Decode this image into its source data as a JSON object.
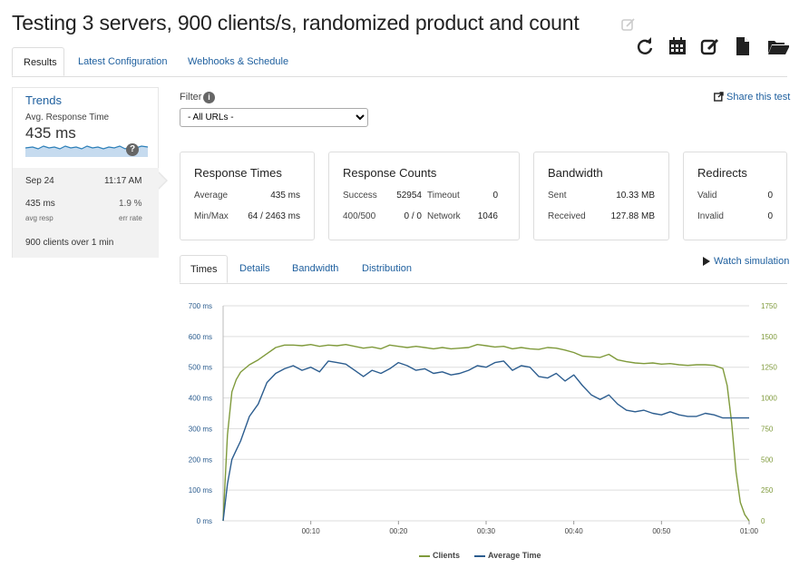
{
  "page": {
    "title": "Testing 3 servers, 900 clients/s, randomized product and count"
  },
  "toolbar": {
    "icons": [
      "refresh-icon",
      "calendar-icon",
      "edit-icon",
      "document-icon",
      "folder-icon"
    ]
  },
  "tabs": [
    {
      "label": "Results",
      "active": true
    },
    {
      "label": "Latest Configuration",
      "active": false
    },
    {
      "label": "Webhooks & Schedule",
      "active": false
    }
  ],
  "sidebar": {
    "trends_title": "Trends",
    "trends_subtitle": "Avg. Response Time",
    "trends_value": "435 ms",
    "help": "?",
    "selected": {
      "date": "Sep 24",
      "time": "11:17 AM",
      "avg_resp_value": "435 ms",
      "avg_resp_label": "avg resp",
      "err_rate_value": "1.9 %",
      "err_rate_label": "err rate",
      "clients_count": "900",
      "clients_text": "clients over 1 min"
    }
  },
  "filter": {
    "label": "Filter",
    "info": "i",
    "selected": "- All URLs -"
  },
  "share": {
    "label": "Share this test"
  },
  "cards": {
    "response_times": {
      "title": "Response Times",
      "average_label": "Average",
      "average_value": "435 ms",
      "minmax_label": "Min/Max",
      "minmax_value": "64 / 2463 ms"
    },
    "response_counts": {
      "title": "Response Counts",
      "success_label": "Success",
      "success_value": "52954",
      "timeout_label": "Timeout",
      "timeout_value": "0",
      "status_label": "400/500",
      "status_value": "0 / 0",
      "network_label": "Network",
      "network_value": "1046"
    },
    "bandwidth": {
      "title": "Bandwidth",
      "sent_label": "Sent",
      "sent_value": "10.33 MB",
      "received_label": "Received",
      "received_value": "127.88 MB"
    },
    "redirects": {
      "title": "Redirects",
      "valid_label": "Valid",
      "valid_value": "0",
      "invalid_label": "Invalid",
      "invalid_value": "0"
    }
  },
  "chart_tabs": [
    {
      "label": "Times",
      "active": true
    },
    {
      "label": "Details",
      "active": false
    },
    {
      "label": "Bandwidth",
      "active": false
    },
    {
      "label": "Distribution",
      "active": false
    }
  ],
  "watch": {
    "label": "Watch simulation"
  },
  "colors": {
    "link": "#1e5f9e",
    "clients": "#7f9a3b",
    "avg_time": "#2c5d8f",
    "spark": "#2c7fb8"
  },
  "chart_data": {
    "type": "line",
    "x_labels": [
      "00:10",
      "00:20",
      "00:30",
      "00:40",
      "00:50",
      "01:00"
    ],
    "x": [
      0,
      0.5,
      1,
      1.5,
      2,
      3,
      4,
      5,
      6,
      7,
      8,
      9,
      10,
      11,
      12,
      13,
      14,
      15,
      16,
      17,
      18,
      19,
      20,
      21,
      22,
      23,
      24,
      25,
      26,
      27,
      28,
      29,
      30,
      31,
      32,
      33,
      34,
      35,
      36,
      37,
      38,
      39,
      40,
      41,
      42,
      43,
      44,
      45,
      46,
      47,
      48,
      49,
      50,
      51,
      52,
      53,
      54,
      55,
      56,
      57,
      57.5,
      58,
      58.5,
      59,
      59.5,
      60
    ],
    "xlim": [
      0,
      60
    ],
    "y_left": {
      "label": "",
      "ticks": [
        "0 ms",
        "100 ms",
        "200 ms",
        "300 ms",
        "400 ms",
        "500 ms",
        "600 ms",
        "700 ms"
      ],
      "range": [
        0,
        700
      ]
    },
    "y_right": {
      "label": "",
      "ticks": [
        "0",
        "250",
        "500",
        "750",
        "1000",
        "1250",
        "1500",
        "1750"
      ],
      "range": [
        0,
        1750
      ]
    },
    "grid": true,
    "legend": "bottom-center",
    "series": [
      {
        "name": "Clients",
        "axis": "right",
        "color": "#7f9a3b",
        "values": [
          0,
          700,
          1050,
          1150,
          1210,
          1270,
          1310,
          1360,
          1410,
          1430,
          1430,
          1425,
          1435,
          1420,
          1430,
          1425,
          1435,
          1420,
          1405,
          1415,
          1400,
          1430,
          1420,
          1410,
          1420,
          1410,
          1400,
          1410,
          1400,
          1405,
          1410,
          1435,
          1425,
          1415,
          1420,
          1400,
          1410,
          1400,
          1395,
          1410,
          1405,
          1390,
          1370,
          1340,
          1335,
          1330,
          1355,
          1310,
          1295,
          1285,
          1280,
          1285,
          1275,
          1280,
          1270,
          1265,
          1270,
          1270,
          1265,
          1240,
          1100,
          800,
          400,
          150,
          50,
          0
        ]
      },
      {
        "name": "Average Time",
        "axis": "left",
        "color": "#2c5d8f",
        "values": [
          0,
          120,
          200,
          230,
          260,
          340,
          380,
          450,
          480,
          495,
          505,
          490,
          500,
          485,
          520,
          515,
          510,
          490,
          470,
          490,
          480,
          495,
          515,
          505,
          490,
          495,
          480,
          485,
          475,
          480,
          490,
          505,
          500,
          515,
          520,
          490,
          505,
          500,
          470,
          465,
          480,
          455,
          475,
          440,
          410,
          395,
          410,
          380,
          360,
          355,
          360,
          350,
          345,
          355,
          345,
          340,
          340,
          350,
          345,
          335,
          335,
          335,
          335,
          335,
          335,
          335
        ]
      }
    ]
  }
}
